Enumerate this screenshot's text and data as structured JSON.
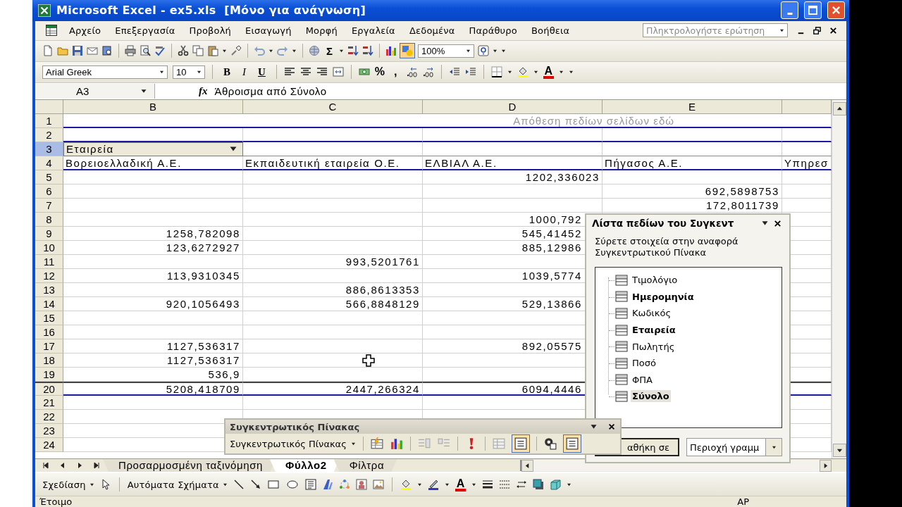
{
  "window": {
    "title": "Microsoft Excel - ex5.xls  [Μόνο για ανάγνωση]"
  },
  "menu": {
    "items": [
      "Αρχείο",
      "Επεξεργασία",
      "Προβολή",
      "Εισαγωγή",
      "Μορφή",
      "Εργαλεία",
      "Δεδομένα",
      "Παράθυρο",
      "Βοήθεια"
    ],
    "help_placeholder": "Πληκτρολογήστε ερώτηση"
  },
  "standard_toolbar": {
    "sum_label": "Σ",
    "zoom": "100%",
    "drawing_pressed": true
  },
  "formatting_toolbar": {
    "font": "Arial Greek",
    "size": "10",
    "style_buttons": [
      {
        "label": "B",
        "kind": "bold"
      },
      {
        "label": "I",
        "kind": "italic"
      },
      {
        "label": "U",
        "kind": "underline"
      }
    ],
    "percent_label": "%",
    "comma_label": ",",
    "font_color_label": "A"
  },
  "formula_bar": {
    "name_box": "A3",
    "function_label": "fx",
    "formula": "Άθροισμα από Σύνολο"
  },
  "grid": {
    "columns": [
      "B",
      "C",
      "D",
      "E"
    ],
    "page_drop_zone": "Απόθεση πεδίων σελίδων εδώ",
    "row_field": "Εταιρεία",
    "rows": [
      {
        "number": "1",
        "kind": "page",
        "selected": false
      },
      {
        "number": "2",
        "kind": "spacer",
        "selected": false
      },
      {
        "number": "3",
        "kind": "field",
        "selected": true
      },
      {
        "number": "4",
        "kind": "items",
        "selected": false,
        "cells": {
          "B": "Βορειοελλαδική Α.Ε.",
          "C": "Εκπαιδευτική εταιρεία Ο.Ε.",
          "D": "ΕΛΒΙΑΛ Α.Ε.",
          "E": "Πήγασος Α.Ε.",
          "column_5": "Υπηρεσ"
        }
      },
      {
        "number": "5",
        "kind": "data",
        "selected": false,
        "cells": {
          "D": "1202,336023"
        }
      },
      {
        "number": "6",
        "kind": "data",
        "selected": false,
        "cells": {
          "E": "692,5898753"
        }
      },
      {
        "number": "7",
        "kind": "data",
        "selected": false,
        "cells": {
          "E": "172,8011739"
        }
      },
      {
        "number": "8",
        "kind": "data",
        "selected": false,
        "cells": {
          "D": "1000,792"
        }
      },
      {
        "number": "9",
        "kind": "data",
        "selected": false,
        "cells": {
          "B": "1258,782098",
          "D": "545,41452"
        }
      },
      {
        "number": "10",
        "kind": "data",
        "selected": false,
        "cells": {
          "B": "123,6272927",
          "D": "885,12986"
        }
      },
      {
        "number": "11",
        "kind": "data",
        "selected": false,
        "cells": {
          "C": "993,5201761"
        }
      },
      {
        "number": "12",
        "kind": "data",
        "selected": false,
        "cells": {
          "B": "113,9310345",
          "D": "1039,5774"
        }
      },
      {
        "number": "13",
        "kind": "data",
        "selected": false,
        "cells": {
          "C": "886,8613353"
        }
      },
      {
        "number": "14",
        "kind": "data",
        "selected": false,
        "cells": {
          "B": "920,1056493",
          "C": "566,8848129",
          "D": "529,13866"
        }
      },
      {
        "number": "15",
        "kind": "data",
        "selected": false
      },
      {
        "number": "16",
        "kind": "data",
        "selected": false
      },
      {
        "number": "17",
        "kind": "data",
        "selected": false,
        "cells": {
          "B": "1127,536317",
          "D": "892,05575"
        }
      },
      {
        "number": "18",
        "kind": "data",
        "selected": false,
        "cells": {
          "B": "1127,536317"
        }
      },
      {
        "number": "19",
        "kind": "data",
        "selected": false,
        "cells": {
          "B": "536,9"
        }
      },
      {
        "number": "20",
        "kind": "total",
        "selected": false,
        "cells": {
          "B": "5208,418709",
          "C": "2447,266324",
          "D": "6094,4446"
        }
      },
      {
        "number": "21",
        "kind": "empty",
        "selected": false
      },
      {
        "number": "22",
        "kind": "empty",
        "selected": false
      },
      {
        "number": "23",
        "kind": "empty",
        "selected": false
      },
      {
        "number": "24",
        "kind": "empty",
        "selected": false
      }
    ]
  },
  "sheet_tabs": [
    {
      "label": "Προσαρμοσμένη ταξινόμηση",
      "selected": false
    },
    {
      "label": "Φύλλο2",
      "selected": true
    },
    {
      "label": "Φίλτρα",
      "selected": false
    }
  ],
  "drawing_toolbar": {
    "draw_menu": "Σχεδίαση",
    "autoshapes_menu": "Αυτόματα Σχήματα",
    "font_color_label": "A"
  },
  "status_bar": {
    "status": "Έτοιμο",
    "indicator": "ΑΡ"
  },
  "field_list": {
    "title": "Λίστα πεδίων του Συγκεντ",
    "instructions": "Σύρετε στοιχεία στην αναφορά Συγκεντρωτικού Πίνακα",
    "fields": [
      {
        "name": "Τιμολόγιο",
        "in_report": false,
        "selected": false
      },
      {
        "name": "Ημερομηνία",
        "in_report": true,
        "selected": false
      },
      {
        "name": "Κωδικός",
        "in_report": false,
        "selected": false
      },
      {
        "name": "Εταιρεία",
        "in_report": true,
        "selected": false
      },
      {
        "name": "Πωλητής",
        "in_report": false,
        "selected": false
      },
      {
        "name": "Ποσό",
        "in_report": false,
        "selected": false
      },
      {
        "name": "ΦΠΑ",
        "in_report": false,
        "selected": false
      },
      {
        "name": "Σύνολο",
        "in_report": true,
        "selected": true
      }
    ],
    "add_button": "αθήκη σε",
    "area_dropdown": "Περιοχή γραμμ"
  },
  "pivot_toolbar": {
    "title": "Συγκεντρωτικός Πίνακας",
    "menu": "Συγκεντρωτικός Πίνακας",
    "always_display_pressed": true,
    "field_list_pressed": true
  }
}
